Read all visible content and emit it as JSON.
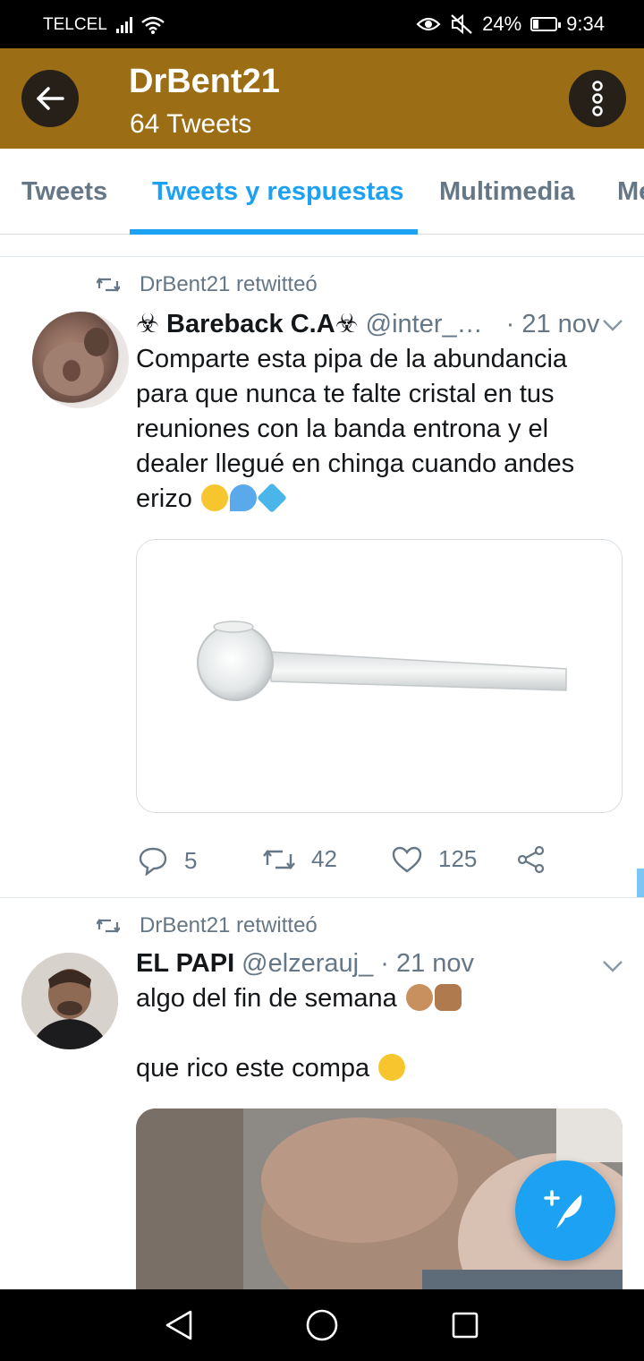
{
  "status_bar": {
    "carrier": "TELCEL",
    "battery_text": "24%",
    "battery_level": 0.24,
    "time": "9:34",
    "icons": [
      "signal-icon",
      "wifi-icon",
      "eye-icon",
      "mute-icon",
      "battery-icon"
    ]
  },
  "header": {
    "title": "DrBent21",
    "subtitle": "64 Tweets",
    "background_color": "#9b6d14"
  },
  "tabs": [
    {
      "label": "Tweets",
      "active": false
    },
    {
      "label": "Tweets y respuestas",
      "active": true
    },
    {
      "label": "Multimedia",
      "active": false
    },
    {
      "label": "Me",
      "active": false
    }
  ],
  "accent_color": "#1da1f2",
  "tweets": [
    {
      "retweet_label": "DrBent21 retwitteó",
      "name": "☣ Bareback C.A☣",
      "handle": "@inter_…",
      "date": "· 21 nov",
      "text": "Comparte esta pipa de la abundancia para que nunca te falte cristal en tus reuniones con la banda entrona y el dealer llegué en chinga cuando andes erizo",
      "emojis": [
        "biohazard-emoji",
        "sweat-droplets-emoji",
        "gem-emoji"
      ],
      "replies": "5",
      "retweets": "42",
      "likes": "125"
    },
    {
      "retweet_label": "DrBent21 retwitteó",
      "name": "EL PAPI",
      "handle": "@elzerauj_",
      "date": "· 21 nov",
      "text_line1": "algo del fin de semana",
      "text_line1_emojis": [
        "ok-hand-emoji",
        "thumbs-up-emoji"
      ],
      "text_line2": "que rico este compa",
      "text_line2_emojis": [
        "drooling-face-emoji"
      ]
    }
  ]
}
